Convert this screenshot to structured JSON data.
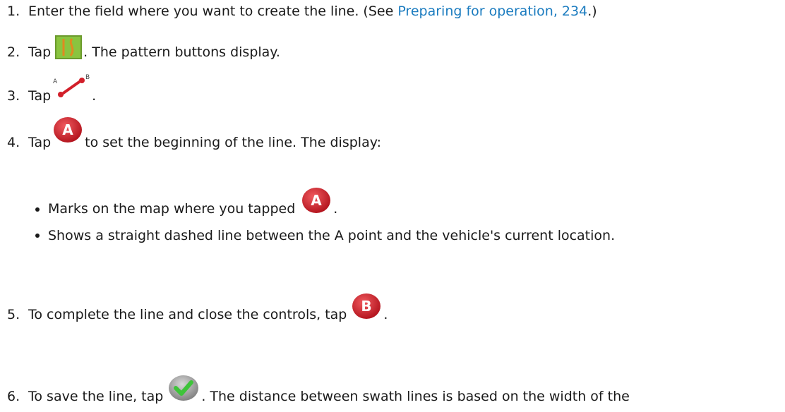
{
  "steps": [
    {
      "num": "1.",
      "text_before": "Enter the field where you want to create the line. (See ",
      "link": "Preparing for operation, 234",
      "text_after": ".)"
    },
    {
      "num": "2.",
      "pre": "Tap",
      "post": ". The pattern buttons display.",
      "icon": "pattern-icon"
    },
    {
      "num": "3.",
      "pre": "Tap",
      "post": ".",
      "icon": "ab-line-icon"
    },
    {
      "num": "4.",
      "pre": "Tap",
      "post": "to set the beginning of the line. The display:",
      "icon": "a-point-icon"
    },
    {
      "num": "5.",
      "pre": "To complete the line and close the controls, tap",
      "post": ".",
      "icon": "b-point-icon"
    },
    {
      "num": "6.",
      "pre": "To save the line, tap",
      "post": ". The distance between swath lines is based on the width of the",
      "icon": "save-check-icon"
    }
  ],
  "bullets": [
    {
      "pre": "Marks on the map where you tapped",
      "post": ".",
      "icon": "a-point-icon"
    },
    {
      "text": "Shows a straight dashed line between the A point and the vehicle's current location."
    }
  ],
  "icon_letters": {
    "a": "A",
    "b": "B"
  },
  "colors": {
    "link": "#1a7bbf",
    "marker_red": "#d21f2a",
    "pattern_green": "#8ac43f",
    "check_green": "#3ec43a"
  }
}
